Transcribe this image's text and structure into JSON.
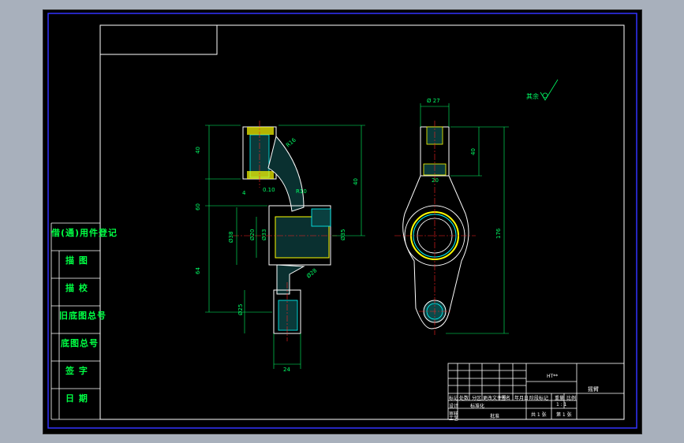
{
  "colors": {
    "frame": "#3333ff",
    "background": "#000000",
    "outline": "#ffffff",
    "dimension": "#00ff66",
    "centerline": "#ff2222",
    "hatch": "#00ffff",
    "part_fill": "#ffff00"
  },
  "side_panel": {
    "title": "借(通)用件登记",
    "rows": [
      "描 图",
      "描 校",
      "旧底图总号",
      "底图总号",
      "签 字",
      "日 期"
    ]
  },
  "title_block": {
    "material": "HT**",
    "part_name": "摇臂",
    "scale_label": "1 : 1",
    "sheet_label": "共 1 张",
    "sheet_no": "第 1 张",
    "headers": [
      "标记",
      "处数",
      "分区",
      "更改文件号",
      "签名",
      "年月日"
    ],
    "roles": [
      "设计",
      "标准化",
      "阶段标记",
      "重量",
      "比例",
      "审核",
      "工艺",
      "批准"
    ]
  },
  "notes": {
    "surface_finish": "其余"
  },
  "dimensions": {
    "front": [
      "40",
      "R16",
      "60",
      "64",
      "4",
      "0.10",
      "R10",
      "Ø38",
      "Ø20",
      "Ø33",
      "Ø35",
      "Ø28",
      "Ø25",
      "24",
      "40"
    ],
    "side": [
      "Ø 27",
      "20",
      "40",
      "176"
    ]
  }
}
